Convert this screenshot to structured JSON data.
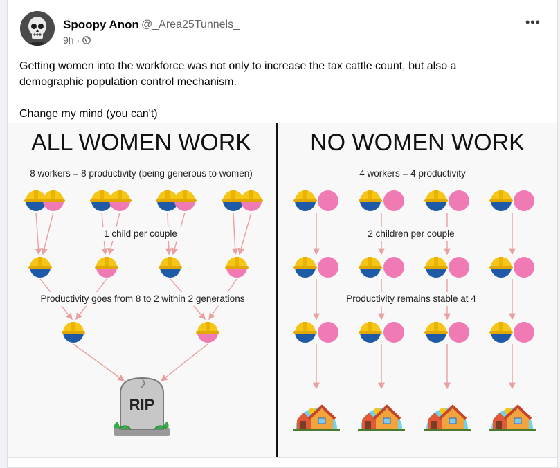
{
  "post": {
    "author_name": "Spoopy Anon",
    "author_handle": "@_Area25Tunnels_",
    "time": "9h",
    "time_separator": "·",
    "privacy_icon": "globe-icon",
    "more_label": "•••",
    "text_line_1": "Getting women into the workforce was not only to increase the tax cattle count, but also a",
    "text_line_2": "demographic population control mechanism.",
    "text_line_3": "Change my mind (you can't)"
  },
  "image": {
    "left_title": "ALL WOMEN WORK",
    "right_title": "NO WOMEN WORK",
    "left_subtitle": "8 workers = 8 productivity (being generous to women)",
    "right_subtitle": "4 workers = 4 productivity",
    "left_children_label": "1 child per couple",
    "right_children_label": "2 children per couple",
    "left_result_label": "Productivity goes from 8 to 2 within 2 generations",
    "right_result_label": "Productivity remains stable at 4",
    "tombstone_text": "RIP",
    "colors": {
      "helmet": "#f5c518",
      "male_body": "#1f5aa6",
      "female_body": "#f07ab4",
      "arrow": "#e8a0a0",
      "divider": "#111111",
      "house_sky": "#6fd3ea"
    }
  }
}
